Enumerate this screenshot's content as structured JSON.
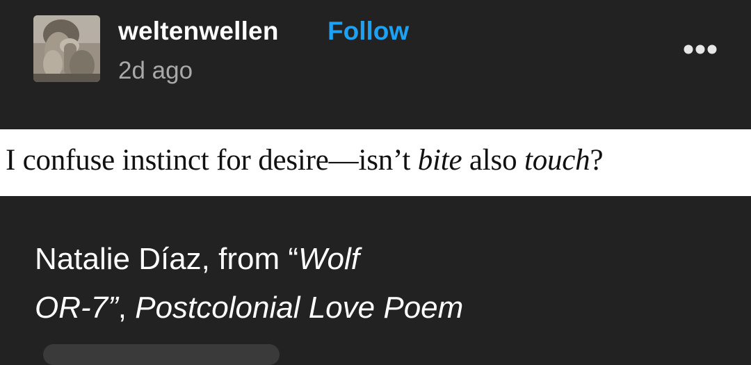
{
  "post": {
    "username": "weltenwellen",
    "follow_label": "Follow",
    "timestamp": "2d ago",
    "more_icon": "more-horizontal-icon"
  },
  "quote": {
    "part1": "I confuse instinct for desire—isn’t ",
    "em1": "bite",
    "part2": " also ",
    "em2": "touch",
    "part3": "?"
  },
  "caption": {
    "line1_plain": "Natalie Díaz, from “",
    "line1_italic": "Wolf",
    "line2_italic": "OR-7”",
    "line2_plain": ", ",
    "line2_italic2": "Postcolonial Love Poem"
  },
  "colors": {
    "background": "#222222",
    "follow": "#1da1f2",
    "timestamp": "#a9a9a9",
    "quote_band": "#ffffff"
  }
}
